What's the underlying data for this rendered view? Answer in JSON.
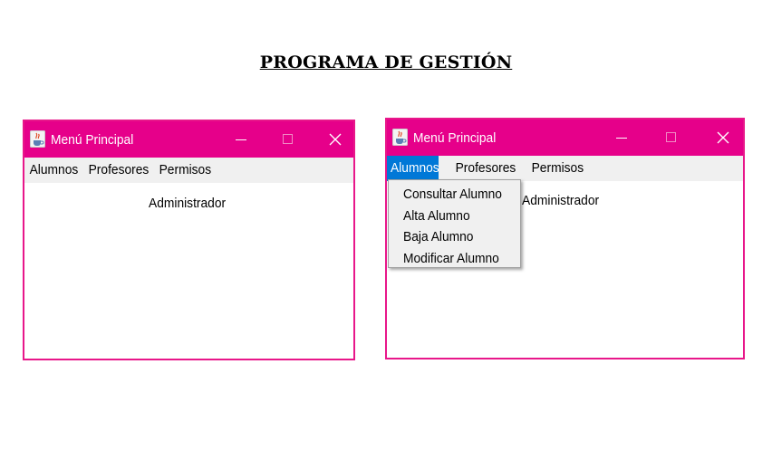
{
  "page": {
    "title": "PROGRAMA DE GESTIÓN"
  },
  "colors": {
    "titlebar": "#e6008a",
    "window_border": "#e8178a",
    "menubar": "#f0f0f0",
    "menu_highlight": "#0078d7"
  },
  "left_window": {
    "title": "Menú Principal",
    "icon": "java-app-icon",
    "controls": [
      "minimize-icon",
      "maximize-icon",
      "close-icon"
    ],
    "menu": [
      "Alumnos",
      "Profesores",
      "Permisos"
    ],
    "content_label": "Administrador"
  },
  "right_window": {
    "title": "Menú Principal",
    "icon": "java-app-icon",
    "controls": [
      "minimize-icon",
      "maximize-icon",
      "close-icon"
    ],
    "menu": [
      "Alumnos",
      "Profesores",
      "Permisos"
    ],
    "active_menu": "Alumnos",
    "content_label": "Administrador",
    "dropdown": [
      "Consultar Alumno",
      "Alta Alumno",
      "Baja Alumno",
      "Modificar Alumno"
    ]
  }
}
